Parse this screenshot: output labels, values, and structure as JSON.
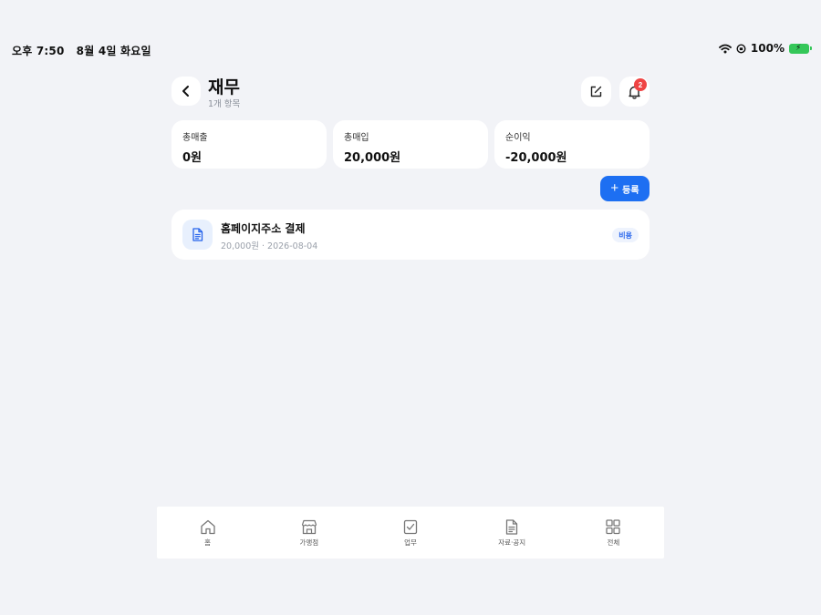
{
  "status": {
    "time": "오후 7:50",
    "date": "8월 4일 화요일",
    "battery": "100%"
  },
  "header": {
    "title": "재무",
    "subtitle": "1개 항목",
    "notification_count": "2"
  },
  "stats": [
    {
      "label": "총매출",
      "value": "0원"
    },
    {
      "label": "총매입",
      "value": "20,000원"
    },
    {
      "label": "순이익",
      "value": "-20,000원"
    }
  ],
  "register_label": "등록",
  "items": [
    {
      "title": "홈페이지주소 결제",
      "meta": "20,000원 · 2026-08-04",
      "tag": "비용"
    }
  ],
  "nav": [
    {
      "label": "홈",
      "icon": "home-icon"
    },
    {
      "label": "가맹점",
      "icon": "store-icon"
    },
    {
      "label": "업무",
      "icon": "task-icon"
    },
    {
      "label": "자료·공지",
      "icon": "document-icon"
    },
    {
      "label": "전체",
      "icon": "grid-icon"
    }
  ],
  "colors": {
    "accent": "#1d6ff2",
    "badge": "#ef4444",
    "background": "#f2f3f7"
  }
}
